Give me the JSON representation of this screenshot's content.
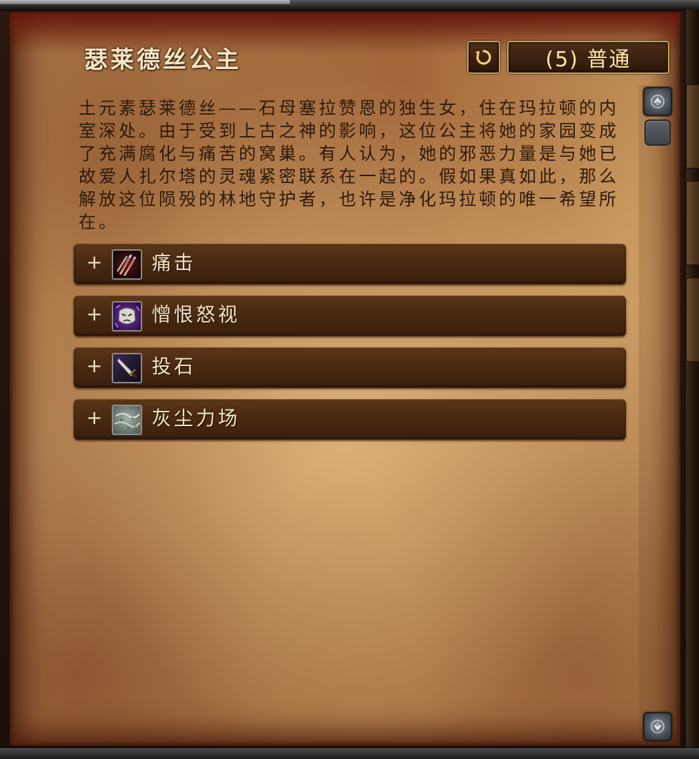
{
  "encounter": {
    "title": "瑟莱德丝公主",
    "difficulty_label": "(5) 普通",
    "description": "土元素瑟莱德丝——石母塞拉赞恩的独生女，住在玛拉顿的内室深处。由于受到上古之神的影响，这位公主将她的家园变成了充满腐化与痛苦的窝巢。有人认为，她的邪恶力量是与她已故爱人扎尔塔的灵魂紧密联系在一起的。假如果真如此，那么解放这位陨殁的林地守护者，也许是净化玛拉顿的唯一希望所在。"
  },
  "abilities": [
    {
      "expand": "+",
      "label": "痛击",
      "icon": "claw-slash-icon"
    },
    {
      "expand": "+",
      "label": "憎恨怒视",
      "icon": "angry-face-icon"
    },
    {
      "expand": "+",
      "label": "投石",
      "icon": "thrown-dagger-icon"
    },
    {
      "expand": "+",
      "label": "灰尘力场",
      "icon": "dust-field-icon"
    }
  ],
  "colors": {
    "title_text": "#f2e6c6",
    "body_text": "#2e1a0c",
    "button_border": "#c9a24a",
    "button_text": "#ffe7a8",
    "row_bg": "#4a2a12"
  }
}
